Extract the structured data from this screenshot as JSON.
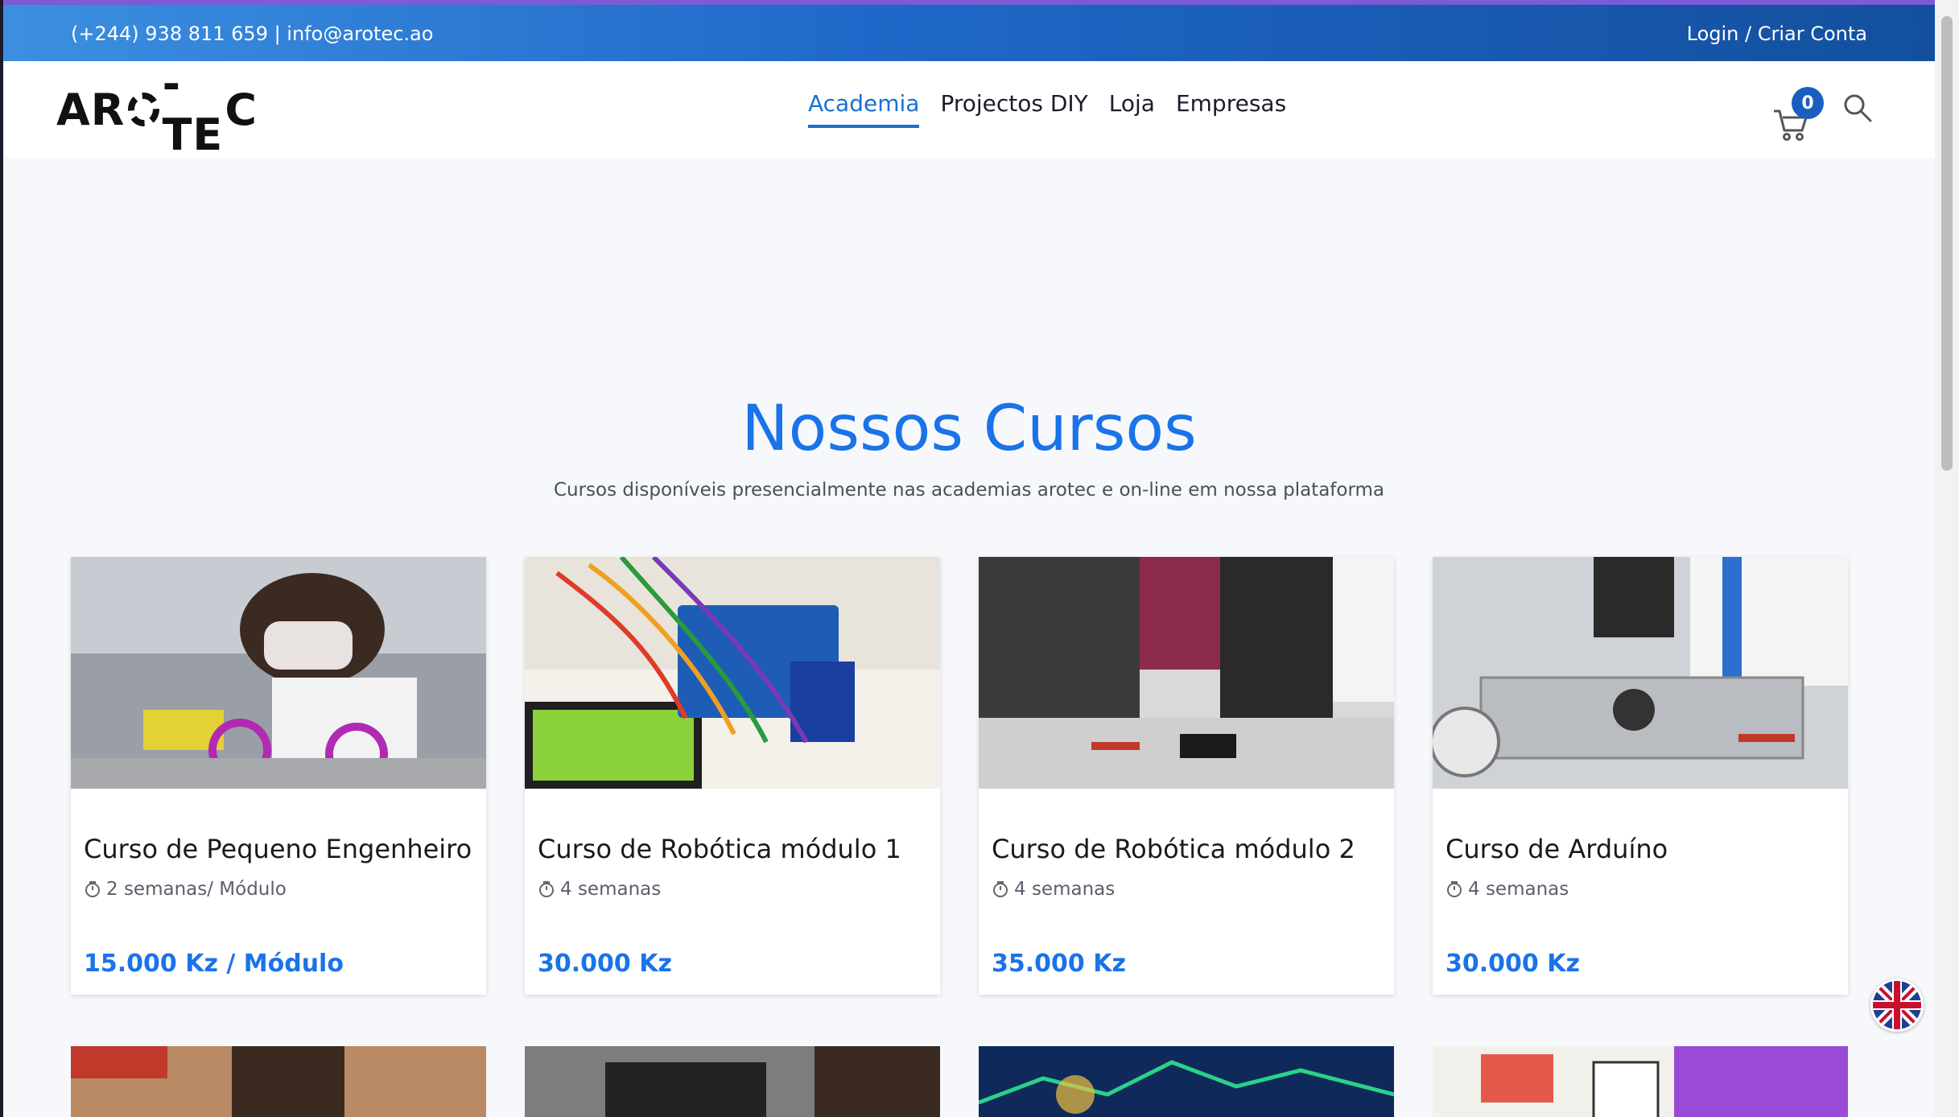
{
  "topbar": {
    "contact": "(+244) 938 811 659 | info@arotec.ao",
    "login": "Login / Criar Conta"
  },
  "navbar": {
    "logo_text": "AR O-TEC",
    "menu": [
      {
        "label": "Academia",
        "active": true
      },
      {
        "label": "Projectos DIY",
        "active": false
      },
      {
        "label": "Loja",
        "active": false
      },
      {
        "label": "Empresas",
        "active": false
      }
    ],
    "cart_count": "0",
    "icons": {
      "cart": "cart-icon",
      "search": "search-icon",
      "language": "uk-flag-icon"
    }
  },
  "hero": {
    "title": "Nossos Cursos",
    "subtitle": "Cursos disponíveis presencialmente nas academias arotec e on-line em nossa plataforma"
  },
  "courses": [
    {
      "title": "Curso de Pequeno Engenheiro",
      "duration": "2 semanas/ Módulo",
      "price": "15.000 Kz / Módulo"
    },
    {
      "title": "Curso de Robótica módulo 1",
      "duration": "4 semanas",
      "price": "30.000 Kz"
    },
    {
      "title": "Curso de Robótica módulo 2",
      "duration": "4 semanas",
      "price": "35.000 Kz"
    },
    {
      "title": "Curso de Arduíno",
      "duration": "4 semanas",
      "price": "30.000 Kz"
    }
  ],
  "colors": {
    "accent": "#1a73e8",
    "topbar_start": "#3c8fe0",
    "topbar_end": "#134f9e",
    "badge": "#1a5fbf"
  }
}
